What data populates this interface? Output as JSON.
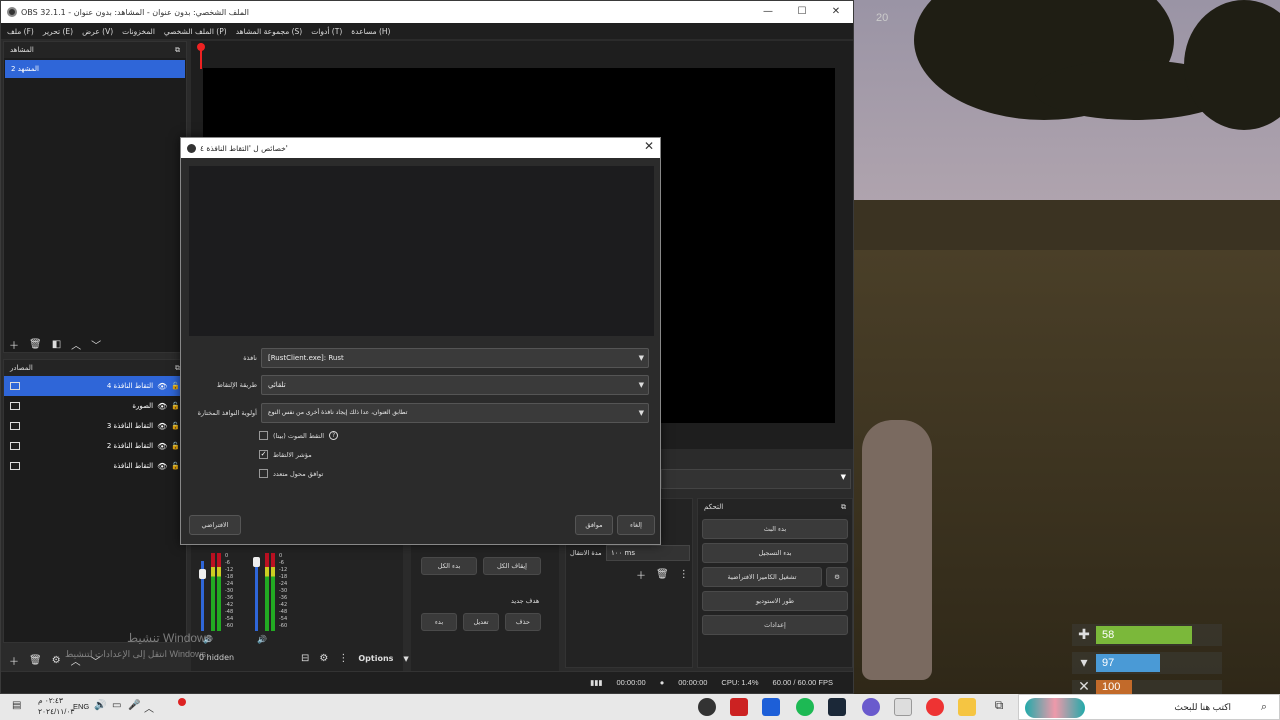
{
  "window": {
    "title": "OBS 32.1.1 - الملف الشخصي: بدون عنوان - المشاهد: بدون عنوان",
    "min": "—",
    "max": "☐",
    "close": "✕"
  },
  "menu": [
    "ملف (F)",
    "تحرير (E)",
    "عرض (V)",
    "المخزونات",
    "الملف الشخصي (P)",
    "مجموعة المشاهد (S)",
    "أدوات (T)",
    "مساعدة (H)"
  ],
  "scenes": {
    "title": "المشاهد",
    "items": [
      "المشهد 2"
    ]
  },
  "sources": {
    "title": "المصادر",
    "items": [
      {
        "name": "التقاط النافذة 4",
        "selected": true
      },
      {
        "name": "الصورة",
        "selected": false
      },
      {
        "name": "التقاط النافذة 3",
        "selected": false
      },
      {
        "name": "التقاط النافذة 2",
        "selected": false
      },
      {
        "name": "التقاط النافذة",
        "selected": false
      }
    ]
  },
  "dialog": {
    "title": "خصائص ل 'التقاط النافذة ٤'",
    "window_label": "نافذة",
    "window_value": "[RustClient.exe]: Rust",
    "method_label": "طريقة الإلتقاط",
    "method_value": "تلقائي",
    "priority_label": "أولوية النوافذ المختارة",
    "priority_value": "تطابق العنوان، عدا ذلك إيجاد نافذة أخرى من نفس النوع",
    "audio_label": "التقط الصوت (بيتا)",
    "audio_help": "?",
    "cursor_label": "مؤشر الالتقاط",
    "multi_label": "توافق محول متعدد",
    "defaults_btn": "الافتراضي",
    "ok_btn": "موافق",
    "cancel_btn": "إلغاء"
  },
  "controls": {
    "title": "التحكم",
    "buttons": [
      "بدء البث",
      "بدء التسجيل",
      "تشغيل الكاميرا الافتراضية",
      "طور الاستوديو",
      "إعدادات"
    ]
  },
  "transitions": {
    "duration_label": "مدة الانتقال",
    "duration_value": "١٠٠ ms"
  },
  "studio": {
    "stop_all": "إيقاف الكل",
    "start_all": "بدء الكل",
    "new_target": "هدف جديد",
    "delete": "حذف",
    "edit": "تعديل",
    "start": "بدء"
  },
  "mixer": {
    "ticks": [
      "0",
      "-6",
      "-12",
      "-18",
      "-24",
      "-30",
      "-36",
      "-42",
      "-48",
      "-54",
      "-60"
    ]
  },
  "bottom": {
    "hidden": "0 hidden",
    "options": "Options"
  },
  "status": {
    "stream_time": "00:00:00",
    "rec_time": "00:00:00",
    "cpu": "CPU: 1.4%",
    "fps": "60.00 / 60.00 FPS"
  },
  "watermark": {
    "line1": "تنشيط Windows",
    "line2": "انتقل إلى الإعدادات لتنشيط Windows"
  },
  "hud": {
    "health": "58",
    "food": "97",
    "water": "100",
    "corner": "20"
  },
  "taskbar": {
    "search": "اكتب هنا للبحث",
    "lang": "ENG",
    "time": "٠٢:٤٣ م",
    "date": "٢٠٢٤/١١/٠٣"
  }
}
